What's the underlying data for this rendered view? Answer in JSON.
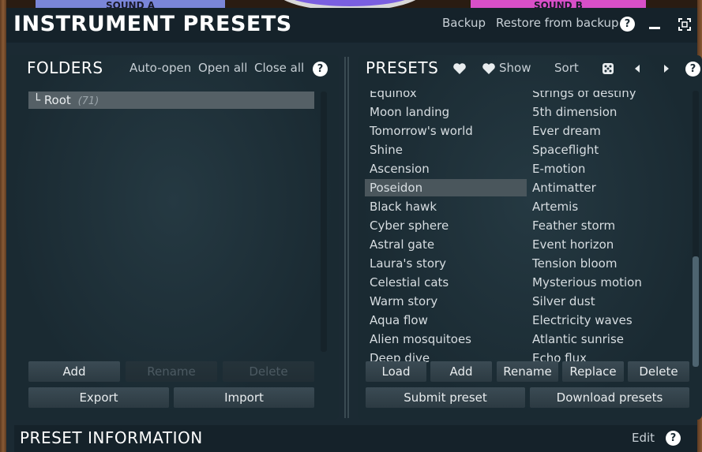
{
  "background": {
    "sound_a_label": "SOUND A",
    "sound_b_label": "SOUND B"
  },
  "window": {
    "title": "INSTRUMENT PRESETS",
    "backup_label": "Backup",
    "restore_label": "Restore from backup",
    "help_label": "?"
  },
  "folders": {
    "title": "FOLDERS",
    "auto_open_label": "Auto-open",
    "open_all_label": "Open all",
    "close_all_label": "Close all",
    "help_label": "?",
    "root_prefix": "└",
    "root_name": "Root",
    "root_count": "(71)",
    "add_label": "Add",
    "rename_label": "Rename",
    "delete_label": "Delete",
    "export_label": "Export",
    "import_label": "Import"
  },
  "presets": {
    "title": "PRESETS",
    "show_label": "Show",
    "sort_label": "Sort",
    "help_label": "?",
    "column1": [
      "Equinox",
      "Moon landing",
      "Tomorrow's world",
      "Shine",
      "Ascension",
      "Poseidon",
      "Black hawk",
      "Cyber sphere",
      "Astral gate",
      "Laura's story",
      "Celestial cats",
      "Warm story",
      "Aqua flow",
      "Alien mosquitoes",
      "Deep dive"
    ],
    "column2": [
      "Strings of destiny",
      "5th dimension",
      "Ever dream",
      "Spaceflight",
      "E-motion",
      "Antimatter",
      "Artemis",
      "Feather storm",
      "Event horizon",
      "Tension bloom",
      "Mysterious motion",
      "Silver dust",
      "Electricity waves",
      "Atlantic sunrise",
      "Echo flux"
    ],
    "selected": "Poseidon",
    "load_label": "Load",
    "add_label": "Add",
    "rename_label": "Rename",
    "replace_label": "Replace",
    "delete_label": "Delete",
    "submit_label": "Submit preset",
    "download_label": "Download presets"
  },
  "info": {
    "title": "PRESET INFORMATION",
    "edit_label": "Edit",
    "help_label": "?"
  },
  "colors": {
    "panel_bg": "#1e2f38",
    "selection": "#4a565c",
    "button": "#34444d"
  }
}
